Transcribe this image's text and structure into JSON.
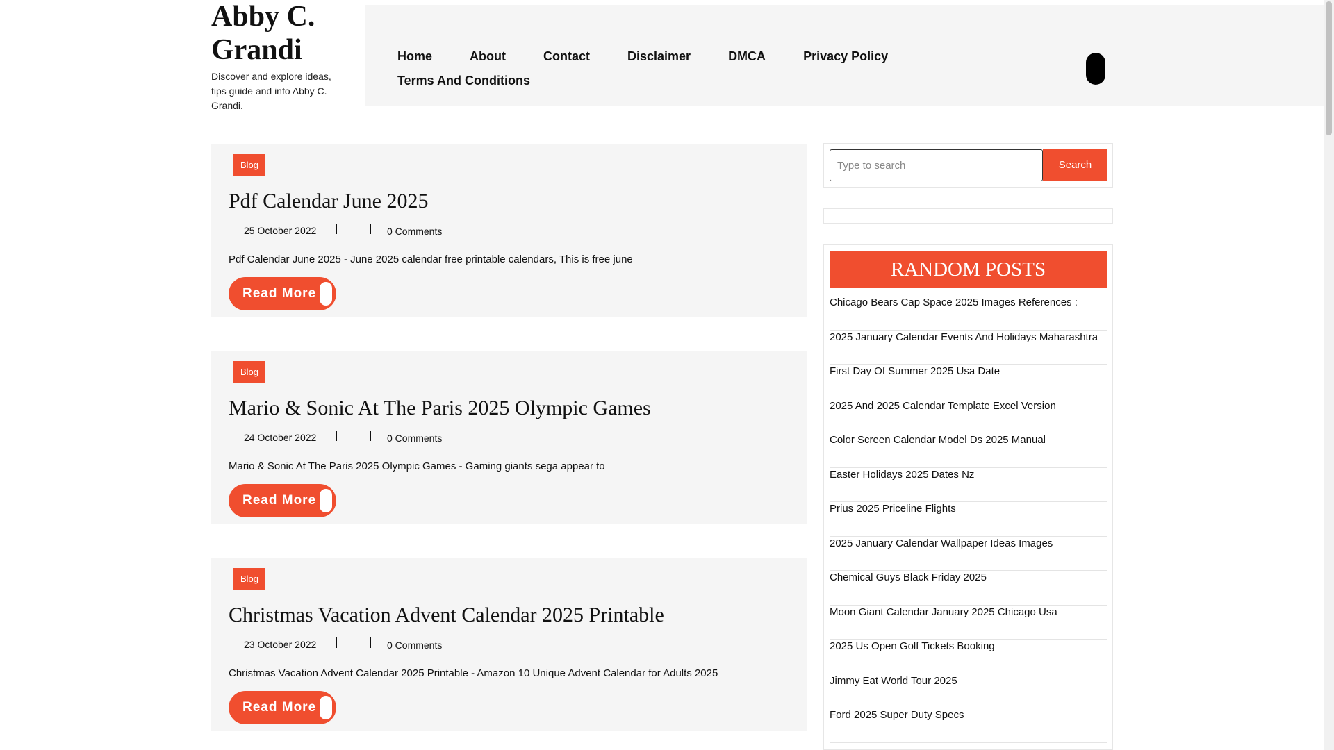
{
  "site": {
    "title_line1": "Abby C.",
    "title_line2": "Grandi",
    "tagline": "Discover and explore ideas, tips guide and info Abby C. Grandi."
  },
  "nav": {
    "items": [
      "Home",
      "About",
      "Contact",
      "Disclaimer",
      "DMCA",
      "Privacy Policy",
      "Terms And Conditions"
    ]
  },
  "posts": [
    {
      "tag": "Blog",
      "title": "Pdf Calendar June 2025",
      "date": "25 October 2022",
      "comments": "0 Comments",
      "excerpt": "Pdf Calendar June 2025 - June 2025 calendar free printable calendars, This is free june",
      "read_more": "Read More"
    },
    {
      "tag": "Blog",
      "title": "Mario & Sonic At The Paris 2025 Olympic Games",
      "date": "24 October 2022",
      "comments": "0 Comments",
      "excerpt": "Mario & Sonic At The Paris 2025 Olympic Games - Gaming giants sega appear to",
      "read_more": "Read More"
    },
    {
      "tag": "Blog",
      "title": "Christmas Vacation Advent Calendar 2025 Printable",
      "date": "23 October 2022",
      "comments": "0 Comments",
      "excerpt": "Christmas Vacation Advent Calendar 2025 Printable - Amazon 10 Unique Advent Calendar for Adults 2025",
      "read_more": "Read More"
    }
  ],
  "search": {
    "placeholder": "Type to search",
    "button_label": "Search"
  },
  "random_posts": {
    "title": "RANDOM POSTS",
    "items": [
      "Chicago Bears Cap Space 2025 Images References :",
      "2025 January Calendar Events And Holidays Maharashtra",
      "First Day Of Summer 2025 Usa Date",
      "2025 And 2025 Calendar Template Excel Version",
      "Color Screen Calendar Model Ds 2025 Manual",
      "Easter Holidays 2025 Dates Nz",
      "Prius 2025 Priceline Flights",
      "2025 January Calendar Wallpaper Ideas Images",
      "Chemical Guys Black Friday 2025",
      "Moon Giant Calendar January 2025 Chicago Usa",
      "2025 Us Open Golf Tickets Booking",
      "Jimmy Eat World Tour 2025",
      "Ford 2025 Super Duty Specs"
    ]
  },
  "colors": {
    "accent": "#f04e2f",
    "panel": "#f5f5f5"
  }
}
